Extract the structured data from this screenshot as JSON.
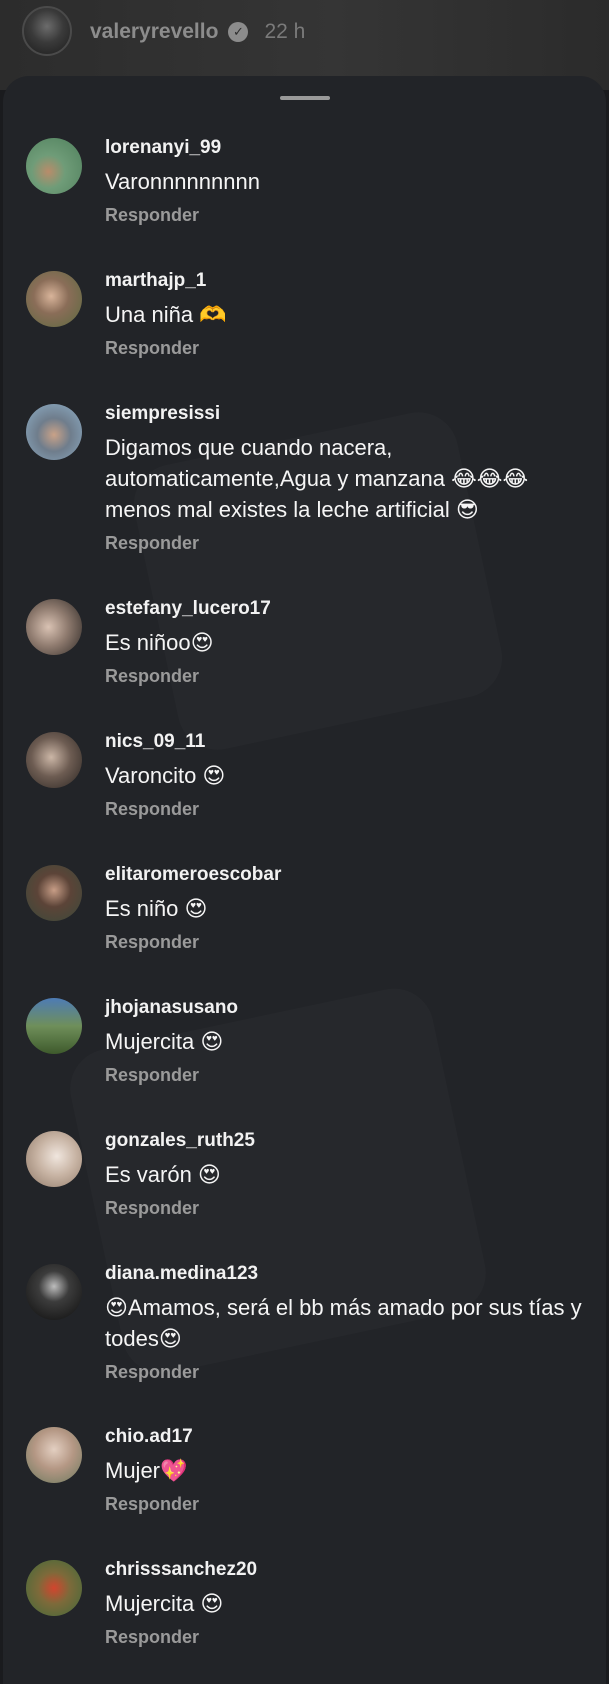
{
  "story": {
    "username": "valeryrevello",
    "time": "22 h"
  },
  "reply_label": "Responder",
  "comments": [
    {
      "username": "lorenanyi_99",
      "text": "Varonnnnnnnnn"
    },
    {
      "username": "marthajp_1",
      "text": "Una niña 🫶"
    },
    {
      "username": "siempresissi",
      "text": "Digamos que cuando nacera, automaticamente,Agua y manzana 😂😂😂 menos mal existes la leche artificial 😎"
    },
    {
      "username": "estefany_lucero17",
      "text": "Es niñoo😍"
    },
    {
      "username": "nics_09_11",
      "text": "Varoncito 😍"
    },
    {
      "username": "elitaromeroescobar",
      "text": "Es niño 😍"
    },
    {
      "username": "jhojanasusano",
      "text": "Mujercita 😍"
    },
    {
      "username": "gonzales_ruth25",
      "text": "Es varón 😍"
    },
    {
      "username": "diana.medina123",
      "text": "😍Amamos, será el bb más amado por sus tías y todes😍"
    },
    {
      "username": "chio.ad17",
      "text": "Mujer💖"
    },
    {
      "username": "chrisssanchez20",
      "text": "Mujercita 😍"
    }
  ]
}
